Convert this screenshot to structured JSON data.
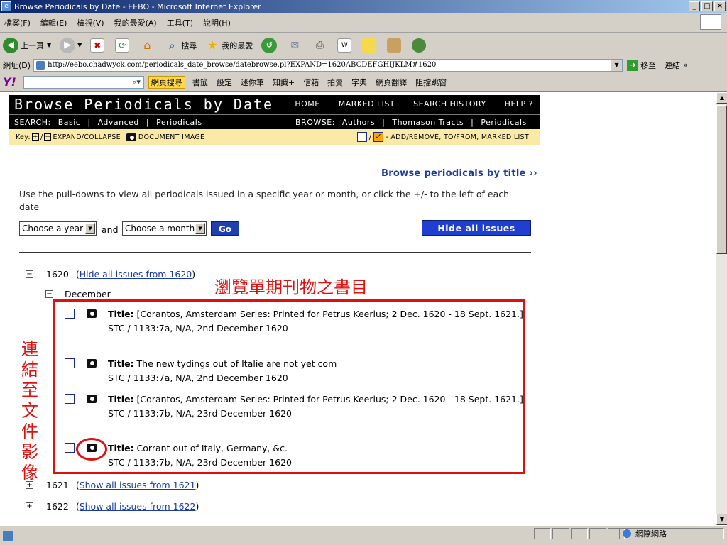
{
  "window": {
    "title": "Browse Periodicals by Date - EEBO - Microsoft Internet Explorer",
    "buttons": [
      "_",
      "□",
      "×"
    ]
  },
  "menu": [
    "檔案(F)",
    "編輯(E)",
    "檢視(V)",
    "我的最愛(A)",
    "工具(T)",
    "說明(H)"
  ],
  "toolbar": {
    "back": "上一頁",
    "search": "搜尋",
    "favorites": "我的最愛"
  },
  "address": {
    "label": "網址(D)",
    "url": "http://eebo.chadwyck.com/periodicals_date_browse/datebrowse.pl?EXPAND=1620ABCDEFGHIJKLM#1620",
    "go": "移至",
    "links": "連結"
  },
  "yahoo": {
    "search_btn": "網頁搜尋",
    "items": [
      "書籤",
      "設定",
      "迷你筆",
      "知識+",
      "信箱",
      "拍賣",
      "字典",
      "網頁翻譯",
      "阻擋跳窗"
    ]
  },
  "page": {
    "title": "Browse Periodicals by Date",
    "nav": [
      "HOME",
      "MARKED LIST",
      "SEARCH HISTORY",
      "HELP ?"
    ],
    "search_label": "SEARCH:",
    "search_links": [
      "Basic",
      "Advanced",
      "Periodicals"
    ],
    "browse_label": "BROWSE:",
    "browse_links": [
      "Authors",
      "Thomason Tracts",
      "Periodicals"
    ],
    "key_label": "Key:",
    "key_expand": "EXPAND/COLLAPSE",
    "key_docimg": "DOCUMENT IMAGE",
    "key_marked": "- ADD/REMOVE, TO/FROM, MARKED LIST",
    "browse_by_title": "Browse periodicals by title ››",
    "instructions": "Use the pull-downs to view all periodicals issued in a specific year or month, or click the +/- to the left of each date",
    "year_select": "Choose a year",
    "and": "and",
    "month_select": "Choose a month",
    "go": "Go",
    "hide_all": "Hide all issues",
    "year1620": "1620",
    "hide1620": "Hide all issues from 1620",
    "month": "December",
    "entries": [
      {
        "label": "Title:",
        "title": "[Corantos, Amsterdam Series: Printed for Petrus Keerius; 2 Dec. 1620 - 18 Sept. 1621.]",
        "meta": "STC / 1133:7a, N/A, 2nd December 1620"
      },
      {
        "label": "Title:",
        "title": "The new tydings out of Italie are not yet com",
        "meta": "STC / 1133:7a, N/A, 2nd December 1620"
      },
      {
        "label": "Title:",
        "title": "[Corantos, Amsterdam Series: Printed for Petrus Keerius; 2 Dec. 1620 - 18 Sept. 1621.]",
        "meta": "STC / 1133:7b, N/A, 23rd December 1620"
      },
      {
        "label": "Title:",
        "title": "Corrant out of Italy, Germany, &c.",
        "meta": "STC / 1133:7b, N/A, 23rd December 1620"
      }
    ],
    "year1621": "1621",
    "show1621": "Show all issues from 1621",
    "year1622": "1622",
    "show1622": "Show all issues from 1622"
  },
  "annotations": {
    "heading": "瀏覽單期刊物之書目",
    "side": "連結至文件影像"
  },
  "status": {
    "zone": "網際網路"
  }
}
